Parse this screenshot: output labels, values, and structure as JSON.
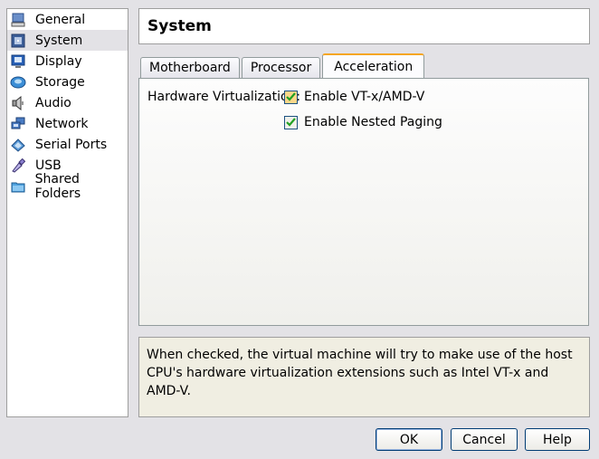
{
  "sidebar": {
    "items": [
      {
        "label": "General",
        "icon": "monitor-icon",
        "selected": false
      },
      {
        "label": "System",
        "icon": "chip-icon",
        "selected": true
      },
      {
        "label": "Display",
        "icon": "display-icon",
        "selected": false
      },
      {
        "label": "Storage",
        "icon": "disk-icon",
        "selected": false
      },
      {
        "label": "Audio",
        "icon": "speaker-icon",
        "selected": false
      },
      {
        "label": "Network",
        "icon": "network-icon",
        "selected": false
      },
      {
        "label": "Serial Ports",
        "icon": "serial-port-icon",
        "selected": false
      },
      {
        "label": "USB",
        "icon": "usb-icon",
        "selected": false
      },
      {
        "label": "Shared Folders",
        "icon": "folder-icon",
        "selected": false
      }
    ]
  },
  "header": {
    "title": "System"
  },
  "tabs": [
    {
      "label": "Motherboard",
      "active": false
    },
    {
      "label": "Processor",
      "active": false
    },
    {
      "label": "Acceleration",
      "active": true
    }
  ],
  "acceleration": {
    "hw_virt_label": "Hardware Virtualization:",
    "options": [
      {
        "label": "Enable VT-x/AMD-V",
        "checked": true
      },
      {
        "label": "Enable Nested Paging",
        "checked": true
      }
    ]
  },
  "description": "When checked, the virtual machine will try to make use of the host CPU's hardware virtualization extensions such as Intel VT-x and AMD-V.",
  "buttons": {
    "ok": "OK",
    "cancel": "Cancel",
    "help": "Help"
  },
  "colors": {
    "active_tab_accent": "#f5a623",
    "check_green": "#21a121",
    "selected_row": "#e3e2e6"
  }
}
